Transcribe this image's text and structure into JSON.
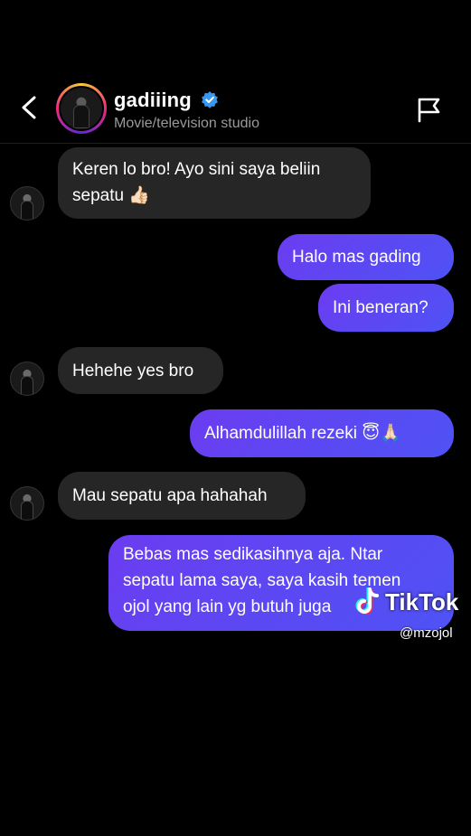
{
  "header": {
    "username": "gadiiing",
    "subtitle": "Movie/television studio",
    "back_icon": "chevron-left-icon",
    "flag_icon": "flag-icon",
    "verified_icon": "verified-badge-icon",
    "verified_color": "#3897f0"
  },
  "messages": [
    {
      "side": "in",
      "lines": [
        "Keren lo bro! Ayo sini saya beliin",
        "sepatu 👍🏻"
      ]
    },
    {
      "side": "out",
      "text": "Halo mas gading"
    },
    {
      "side": "out",
      "text": "Ini beneran?"
    },
    {
      "side": "in",
      "text": "Hehehe yes bro"
    },
    {
      "side": "out",
      "text": "Alhamdulillah rezeki 😇🙏🏻"
    },
    {
      "side": "in",
      "text": "Mau sepatu apa hahahah"
    },
    {
      "side": "out",
      "lines": [
        "Bebas mas sedikasihnya aja. Ntar",
        "sepatu lama saya, saya kasih temen",
        "ojol yang lain yg butuh juga"
      ]
    }
  ],
  "watermark": {
    "brand": "TikTok",
    "handle": "@mzojol"
  },
  "colors": {
    "incoming_bubble": "#262626",
    "outgoing_bubble": "#5b48f2",
    "background": "#000000"
  }
}
